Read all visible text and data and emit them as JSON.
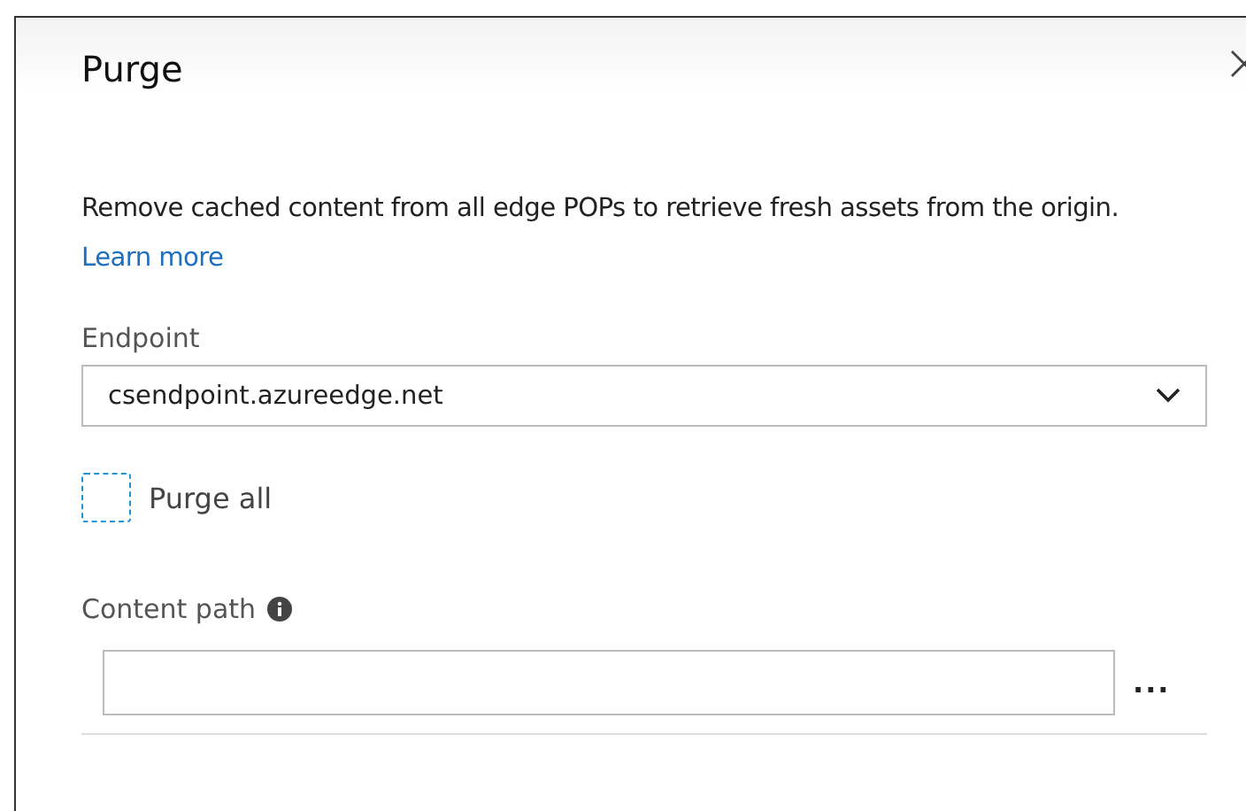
{
  "panel": {
    "title": "Purge",
    "description": "Remove cached content from all edge POPs to retrieve fresh assets from the origin.",
    "learn_more": "Learn more"
  },
  "endpoint": {
    "label": "Endpoint",
    "value": "csendpoint.azureedge.net"
  },
  "purge_all": {
    "label": "Purge all",
    "checked": false
  },
  "content_path": {
    "label": "Content path",
    "more": "..."
  }
}
